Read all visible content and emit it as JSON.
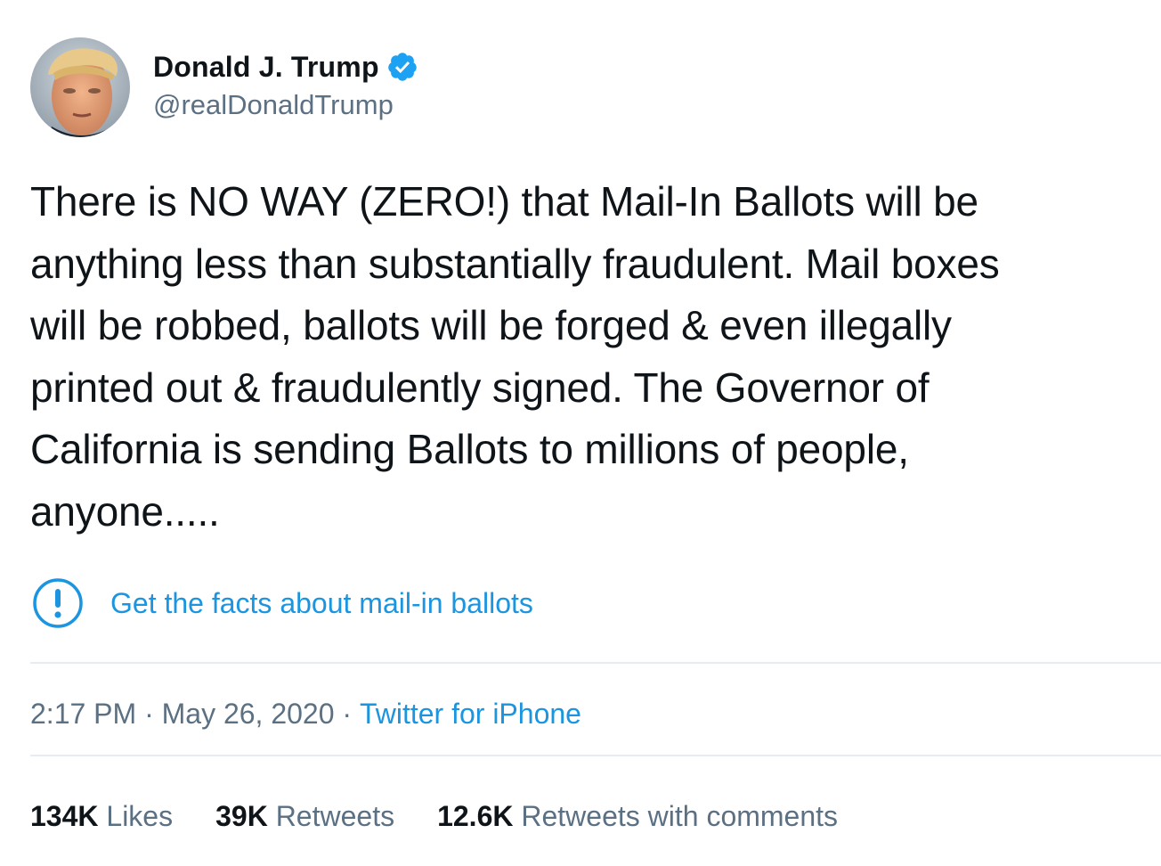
{
  "tweet": {
    "author": {
      "display_name": "Donald J. Trump",
      "handle": "@realDonaldTrump",
      "verified": true,
      "avatar_icon": "profile-photo"
    },
    "text": "There is NO WAY (ZERO!) that Mail-In Ballots will be\nanything less than substantially fraudulent. Mail boxes\nwill be robbed, ballots will be forged & even illegally\nprinted out & fraudulently signed. The Governor of\nCalifornia is sending Ballots to millions of people,\nanyone.....",
    "fact_check": {
      "icon": "exclamation-circle-icon",
      "label": "Get the facts about mail-in ballots"
    },
    "time": "2:17 PM",
    "separator": " · ",
    "date": "May 26, 2020",
    "source": "Twitter for iPhone",
    "stats": {
      "likes": {
        "count": "134K",
        "label": " Likes"
      },
      "retweets": {
        "count": "39K",
        "label": " Retweets"
      },
      "quotes": {
        "count": "12.6K",
        "label": " Retweets with comments"
      }
    }
  },
  "colors": {
    "text": "#0f1419",
    "secondary": "#5b7083",
    "link": "#1b95e0",
    "verified": "#1da1f2",
    "divider": "#e6ecf0"
  }
}
